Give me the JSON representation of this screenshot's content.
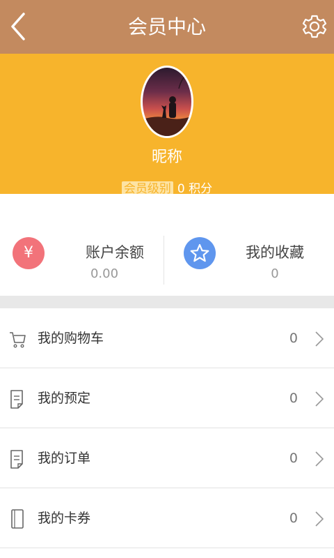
{
  "header": {
    "title": "会员中心"
  },
  "profile": {
    "nickname": "昵称",
    "level_label": "会员级别",
    "points_text": "0 积分"
  },
  "stats": {
    "balance": {
      "icon": "yen-icon",
      "glyph": "¥",
      "label": "账户余额",
      "value": "0.00",
      "color": "#f2737a"
    },
    "favorites": {
      "icon": "star-icon",
      "label": "我的收藏",
      "value": "0",
      "color": "#5f96ee"
    }
  },
  "menu": [
    {
      "icon": "cart-icon",
      "label": "我的购物车",
      "count": "0"
    },
    {
      "icon": "document-icon",
      "label": "我的预定",
      "count": "0"
    },
    {
      "icon": "document-icon",
      "label": "我的订单",
      "count": "0"
    },
    {
      "icon": "card-icon",
      "label": "我的卡券",
      "count": "0"
    }
  ],
  "colors": {
    "header": "#c38a5f",
    "profile_bg": "#f7b42c",
    "gap": "#e8e8e8"
  }
}
